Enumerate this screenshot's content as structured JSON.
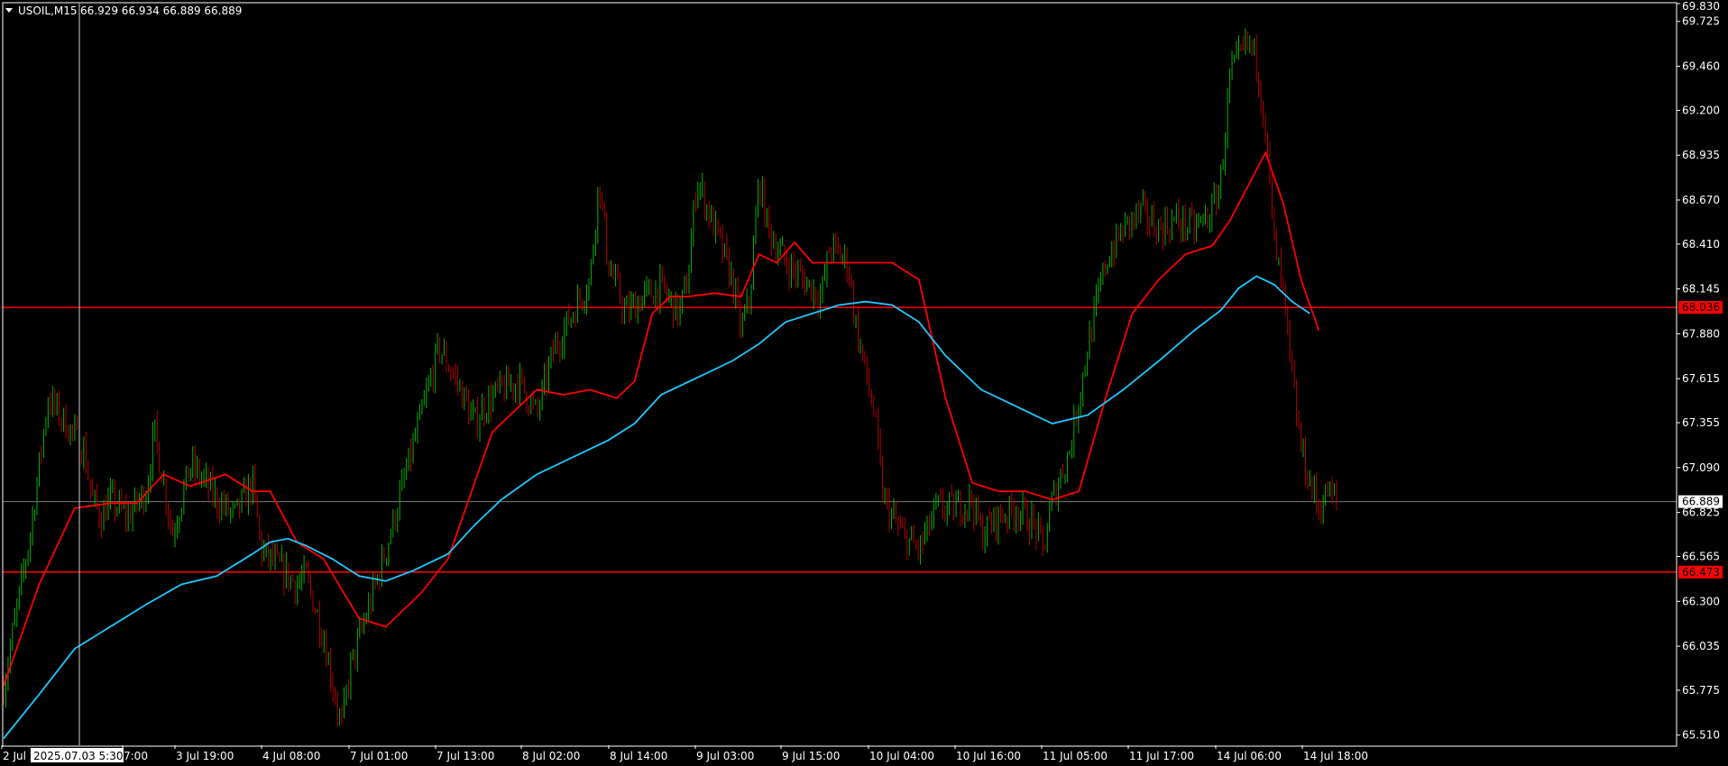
{
  "header": {
    "symbol": "USOIL,M15",
    "ohlc": "66.929 66.934 66.889 66.889",
    "dropdown_icon": "triangle-down-icon"
  },
  "crosshair": {
    "time_label": "2025.07.03 5:30"
  },
  "colors": {
    "background": "#000000",
    "frame": "#ffffff",
    "bull_candle": "#00b400",
    "bear_candle": "#b40000",
    "fast_ma": "#ff0000",
    "slow_ma": "#1ec8ff",
    "level_line": "#ff0000",
    "bid_line": "#7a7a7a"
  },
  "chart_data": {
    "type": "line",
    "symbol": "USOIL",
    "timeframe": "M15",
    "ylim": [
      65.45,
      69.83
    ],
    "y_ticks": [
      "69.830",
      "69.725",
      "69.460",
      "69.200",
      "68.935",
      "68.670",
      "68.410",
      "68.145",
      "67.880",
      "67.615",
      "67.355",
      "67.090",
      "66.825",
      "66.565",
      "66.300",
      "66.035",
      "65.775",
      "65.510"
    ],
    "x_tick_labels": [
      "2 Jul 2025",
      "2 Jul 07:00",
      "3 Jul 19:00",
      "4 Jul 08:00",
      "7 Jul 01:00",
      "7 Jul 13:00",
      "8 Jul 02:00",
      "8 Jul 14:00",
      "9 Jul 03:00",
      "9 Jul 15:00",
      "10 Jul 04:00",
      "10 Jul 16:00",
      "11 Jul 05:00",
      "11 Jul 17:00",
      "14 Jul 06:00",
      "14 Jul 18:00"
    ],
    "x_tick_displayed": [
      "2 Jul 2",
      "2025.07.03 5:30",
      "7:00",
      "3 Jul 19:00",
      "4 Jul 08:00",
      "7 Jul 01:00",
      "7 Jul 13:00",
      "8 Jul 02:00",
      "8 Jul 14:00",
      "9 Jul 03:00",
      "9 Jul 15:00",
      "10 Jul 04:00",
      "10 Jul 16:00",
      "11 Jul 05:00",
      "11 Jul 17:00",
      "14 Jul 06:00",
      "14 Jul 18:00"
    ],
    "horizontal_levels": [
      {
        "price": 68.036,
        "label": "68.036"
      },
      {
        "price": 66.473,
        "label": "66.473"
      }
    ],
    "bid": {
      "price": 66.889,
      "label": "66.889"
    },
    "price_path": [
      [
        0,
        65.8
      ],
      [
        3,
        66.7
      ],
      [
        5,
        67.5
      ],
      [
        7,
        67.35
      ],
      [
        9,
        67.2
      ],
      [
        10,
        66.9
      ],
      [
        11,
        66.8
      ],
      [
        12,
        66.9
      ],
      [
        13,
        66.85
      ],
      [
        14,
        66.8
      ],
      [
        16,
        66.95
      ],
      [
        17,
        67.3
      ],
      [
        19,
        66.7
      ],
      [
        21,
        67.1
      ],
      [
        22,
        67.05
      ],
      [
        24,
        66.9
      ],
      [
        26,
        66.8
      ],
      [
        28,
        67.0
      ],
      [
        29,
        66.6
      ],
      [
        31,
        66.5
      ],
      [
        33,
        66.4
      ],
      [
        34,
        66.45
      ],
      [
        36,
        66.1
      ],
      [
        38,
        65.55
      ],
      [
        39,
        65.9
      ],
      [
        41,
        66.25
      ],
      [
        43,
        66.6
      ],
      [
        45,
        67.0
      ],
      [
        47,
        67.4
      ],
      [
        49,
        67.8
      ],
      [
        51,
        67.6
      ],
      [
        53,
        67.35
      ],
      [
        54,
        67.45
      ],
      [
        56,
        67.55
      ],
      [
        58,
        67.6
      ],
      [
        60,
        67.4
      ],
      [
        62,
        67.8
      ],
      [
        64,
        68.0
      ],
      [
        66,
        68.2
      ],
      [
        67,
        68.8
      ],
      [
        68,
        68.3
      ],
      [
        70,
        68.0
      ],
      [
        72,
        68.1
      ],
      [
        74,
        68.15
      ],
      [
        76,
        68.0
      ],
      [
        77,
        68.2
      ],
      [
        78,
        68.8
      ],
      [
        80,
        68.5
      ],
      [
        82,
        68.2
      ],
      [
        83,
        67.9
      ],
      [
        84,
        68.1
      ],
      [
        85,
        68.8
      ],
      [
        86,
        68.5
      ],
      [
        88,
        68.3
      ],
      [
        90,
        68.2
      ],
      [
        92,
        68.1
      ],
      [
        93,
        68.4
      ],
      [
        95,
        68.3
      ],
      [
        96,
        67.9
      ],
      [
        98,
        67.4
      ],
      [
        99,
        66.9
      ],
      [
        101,
        66.7
      ],
      [
        103,
        66.6
      ],
      [
        105,
        66.85
      ],
      [
        107,
        66.85
      ],
      [
        109,
        66.9
      ],
      [
        110,
        66.7
      ],
      [
        112,
        66.8
      ],
      [
        114,
        66.85
      ],
      [
        116,
        66.75
      ],
      [
        117,
        66.6
      ],
      [
        118,
        66.9
      ],
      [
        120,
        67.2
      ],
      [
        122,
        67.8
      ],
      [
        124,
        68.3
      ],
      [
        126,
        68.5
      ],
      [
        128,
        68.6
      ],
      [
        130,
        68.5
      ],
      [
        132,
        68.55
      ],
      [
        134,
        68.5
      ],
      [
        136,
        68.6
      ],
      [
        137,
        68.8
      ],
      [
        138,
        69.4
      ],
      [
        140,
        69.6
      ],
      [
        141,
        69.5
      ],
      [
        142,
        69.1
      ],
      [
        143,
        68.4
      ],
      [
        144,
        68.1
      ],
      [
        145,
        67.6
      ],
      [
        146,
        67.2
      ],
      [
        147,
        67.0
      ],
      [
        148,
        66.85
      ],
      [
        149,
        66.95
      ],
      [
        150,
        66.889
      ]
    ],
    "series": [
      {
        "legend": "",
        "role": "fast moving average",
        "color": "#ff0000",
        "points": [
          [
            0,
            65.8
          ],
          [
            4,
            66.4
          ],
          [
            8,
            66.85
          ],
          [
            12,
            66.88
          ],
          [
            15,
            66.88
          ],
          [
            18,
            67.05
          ],
          [
            21,
            66.98
          ],
          [
            25,
            67.05
          ],
          [
            28,
            66.95
          ],
          [
            30,
            66.95
          ],
          [
            33,
            66.65
          ],
          [
            36,
            66.55
          ],
          [
            40,
            66.2
          ],
          [
            43,
            66.15
          ],
          [
            47,
            66.35
          ],
          [
            50,
            66.55
          ],
          [
            53,
            67.0
          ],
          [
            55,
            67.3
          ],
          [
            58,
            67.45
          ],
          [
            60,
            67.55
          ],
          [
            63,
            67.52
          ],
          [
            66,
            67.55
          ],
          [
            69,
            67.5
          ],
          [
            71,
            67.6
          ],
          [
            73,
            68.0
          ],
          [
            75,
            68.1
          ],
          [
            77,
            68.1
          ],
          [
            80,
            68.12
          ],
          [
            83,
            68.1
          ],
          [
            85,
            68.35
          ],
          [
            87,
            68.3
          ],
          [
            89,
            68.42
          ],
          [
            91,
            68.3
          ],
          [
            94,
            68.3
          ],
          [
            97,
            68.3
          ],
          [
            100,
            68.3
          ],
          [
            103,
            68.2
          ],
          [
            106,
            67.5
          ],
          [
            109,
            67.0
          ],
          [
            112,
            66.95
          ],
          [
            115,
            66.95
          ],
          [
            118,
            66.9
          ],
          [
            121,
            66.95
          ],
          [
            124,
            67.5
          ],
          [
            127,
            68.0
          ],
          [
            130,
            68.2
          ],
          [
            133,
            68.35
          ],
          [
            136,
            68.4
          ],
          [
            138,
            68.55
          ],
          [
            140,
            68.75
          ],
          [
            142,
            68.95
          ],
          [
            144,
            68.65
          ],
          [
            146,
            68.2
          ],
          [
            148,
            67.9
          ]
        ]
      },
      {
        "legend": "",
        "role": "slow moving average",
        "color": "#1ec8ff",
        "points": [
          [
            0,
            65.49
          ],
          [
            4,
            65.75
          ],
          [
            8,
            66.02
          ],
          [
            12,
            66.15
          ],
          [
            16,
            66.28
          ],
          [
            20,
            66.4
          ],
          [
            24,
            66.45
          ],
          [
            28,
            66.58
          ],
          [
            30,
            66.65
          ],
          [
            32,
            66.67
          ],
          [
            34,
            66.63
          ],
          [
            37,
            66.55
          ],
          [
            40,
            66.45
          ],
          [
            43,
            66.42
          ],
          [
            46,
            66.48
          ],
          [
            50,
            66.58
          ],
          [
            53,
            66.75
          ],
          [
            56,
            66.9
          ],
          [
            60,
            67.05
          ],
          [
            64,
            67.15
          ],
          [
            68,
            67.25
          ],
          [
            71,
            67.35
          ],
          [
            74,
            67.52
          ],
          [
            78,
            67.62
          ],
          [
            82,
            67.72
          ],
          [
            85,
            67.82
          ],
          [
            88,
            67.95
          ],
          [
            91,
            68.0
          ],
          [
            94,
            68.05
          ],
          [
            97,
            68.07
          ],
          [
            100,
            68.05
          ],
          [
            103,
            67.95
          ],
          [
            106,
            67.75
          ],
          [
            110,
            67.55
          ],
          [
            114,
            67.45
          ],
          [
            118,
            67.35
          ],
          [
            122,
            67.4
          ],
          [
            126,
            67.55
          ],
          [
            130,
            67.72
          ],
          [
            134,
            67.9
          ],
          [
            137,
            68.02
          ],
          [
            139,
            68.15
          ],
          [
            141,
            68.22
          ],
          [
            143,
            68.17
          ],
          [
            145,
            68.07
          ],
          [
            147,
            68.0
          ]
        ]
      }
    ]
  }
}
